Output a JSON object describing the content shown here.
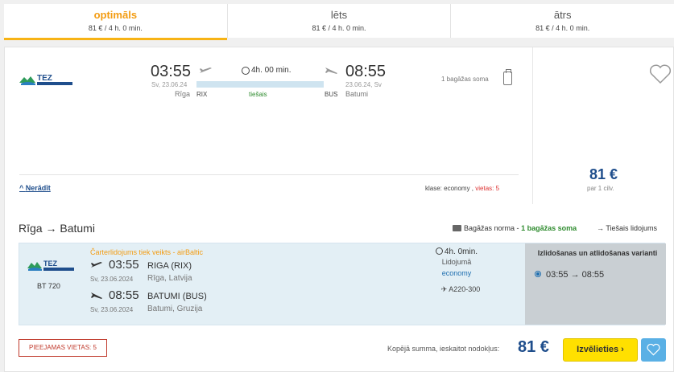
{
  "tabs": [
    {
      "name": "optimāls",
      "sub": "81 € / 4 h. 0 min."
    },
    {
      "name": "lēts",
      "sub": "81 € / 4 h. 0 min."
    },
    {
      "name": "ātrs",
      "sub": "81 € / 4 h. 0 min."
    }
  ],
  "summary": {
    "dep_time": "03:55",
    "dep_date": "Sv, 23.06.24",
    "dep_city": "Rīga",
    "dep_code": "RIX",
    "arr_time": "08:55",
    "arr_date": "23.06.24, Sv",
    "arr_city": "Batumi",
    "arr_code": "BUS",
    "duration": "4h. 00 min.",
    "direct": "tiešais",
    "baggage": "1 bagāžas soma",
    "hide": "Nerādīt",
    "class_label": "klase: economy ,",
    "seats_label": "vietas: 5",
    "price": "81 €",
    "per_person": "par 1 cilv."
  },
  "route": {
    "title": "Rīga → Batumi",
    "baggage_norm": "Bagāžas norma -",
    "baggage_value": "1 bagāžas soma",
    "direct_flights": "→ Tiešais lidojums"
  },
  "detail": {
    "flight_code": "BT 720",
    "charter": "Čarterlidojums tiek veikts - airBaltic",
    "dep_time": "03:55",
    "dep_date": "Sv, 23.06.2024",
    "dep_airport": "RIGA (RIX)",
    "dep_city": "Rīga, Latvija",
    "arr_time": "08:55",
    "arr_date": "Sv, 23.06.2024",
    "arr_airport": "BATUMI (BUS)",
    "arr_city": "Batumi, Gruzija",
    "duration": "4h. 0min.",
    "flight_label": "Lidojumā",
    "class": "economy",
    "aircraft": "A220-300",
    "variant_title": "Izlidošanas un atlidošanas varianti",
    "variant_option": "03:55 → 08:55"
  },
  "footer": {
    "seats": "PIEEJAMAS VIETAS: 5",
    "total_label": "Kopējā summa, ieskaitot nodokļus:",
    "total": "81 €",
    "select": "Izvēlieties ›"
  },
  "colors": {
    "accent": "#f7b315",
    "price": "#1f4e8c",
    "button": "#ffe000"
  }
}
